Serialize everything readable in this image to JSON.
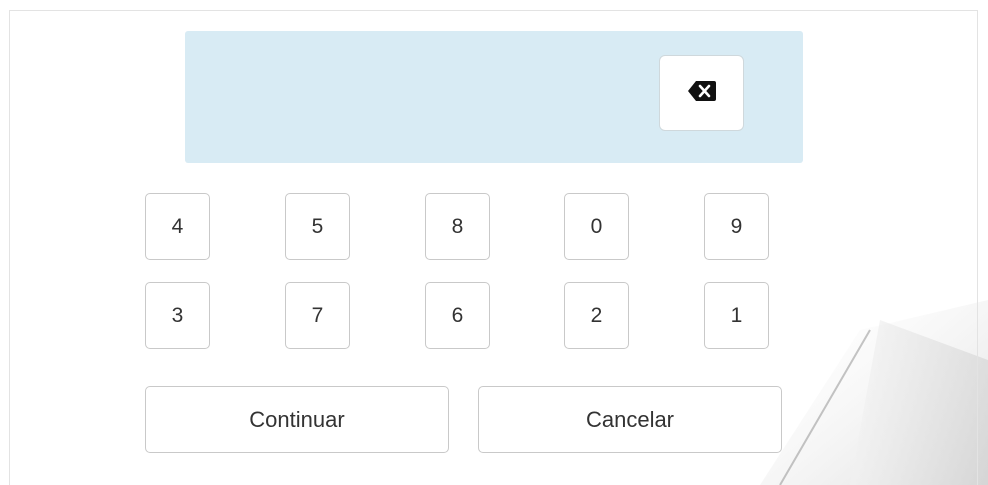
{
  "keypad": {
    "row1": [
      "4",
      "5",
      "8",
      "0",
      "9"
    ],
    "row2": [
      "3",
      "7",
      "6",
      "2",
      "1"
    ]
  },
  "display": {
    "value": ""
  },
  "actions": {
    "continue_label": "Continuar",
    "cancel_label": "Cancelar"
  },
  "icons": {
    "backspace": "backspace-icon"
  },
  "colors": {
    "display_background": "#d8ebf4",
    "key_border": "#c9c9c9",
    "text": "#333333"
  }
}
